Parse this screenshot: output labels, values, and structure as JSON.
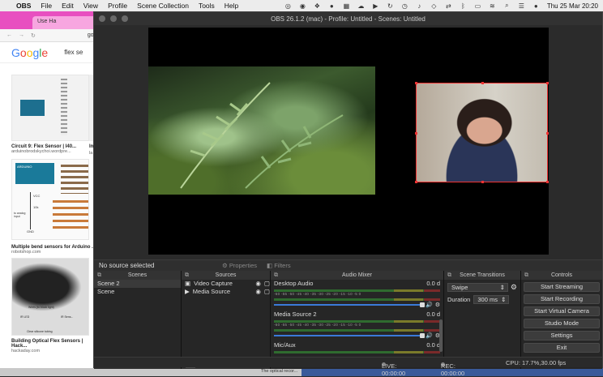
{
  "menubar": {
    "app": "OBS",
    "items": [
      "File",
      "Edit",
      "View",
      "Profile",
      "Scene Collection",
      "Tools",
      "Help"
    ],
    "clock": "Thu 25 Mar  20:20"
  },
  "browser": {
    "tab": "Use Ha",
    "url": "goo",
    "query": "flex se",
    "results": [
      {
        "title": "Circuit 9: Flex Sensor | I40...",
        "source": "arduinobrodskychoi.wordpre..."
      },
      {
        "title": "Multiple bend sensors for Arduino ...",
        "source": "robotshop.com"
      },
      {
        "title": "Building Optical Flex Sensors | Hack...",
        "source": "hackaday.com"
      }
    ],
    "side_snip": "In",
    "side_snip2": "la",
    "diagram_labels": [
      "ARDUINO",
      "VCC",
      "10k",
      "to analog input",
      "GND"
    ],
    "optical_labels": [
      "Wires (to block light)",
      "IR LED",
      "IR Sens...",
      "Clear silicone tubing"
    ],
    "bottom_text": "The optical recor..."
  },
  "window": {
    "title": "OBS 26.1.2 (mac) - Profile: Untitled - Scenes: Untitled"
  },
  "sourcebar": {
    "label": "No source selected",
    "properties": "Properties",
    "filters": "Filters"
  },
  "scenes": {
    "title": "Scenes",
    "items": [
      "Scene 2",
      "Scene"
    ]
  },
  "sources": {
    "title": "Sources",
    "items": [
      "Video Capture",
      "Media Source"
    ]
  },
  "mixer": {
    "title": "Audio Mixer",
    "channels": [
      {
        "name": "Desktop Audio",
        "db": "0.0 d"
      },
      {
        "name": "Media Source 2",
        "db": "0.0 d"
      },
      {
        "name": "Mic/Aux",
        "db": "0.0 d"
      }
    ],
    "ticks": "-60 -55 -50 -45 -40 -35 -30 -25 -20 -15 -10 -5 0"
  },
  "transitions": {
    "title": "Scene Transitions",
    "selected": "Swipe",
    "duration_label": "Duration",
    "duration": "300 ms"
  },
  "controls": {
    "title": "Controls",
    "buttons": [
      "Start Streaming",
      "Start Recording",
      "Start Virtual Camera",
      "Studio Mode",
      "Settings",
      "Exit"
    ]
  },
  "status": {
    "live": "LIVE: 00:00:00",
    "rec": "REC: 00:00:00",
    "cpu": "CPU: 17.7%,30.00 fps"
  },
  "icons": {
    "apple": "apple-icon",
    "gear": "gear-icon",
    "eye": "eye-icon",
    "lock": "lock-icon",
    "speaker": "speaker-icon"
  }
}
